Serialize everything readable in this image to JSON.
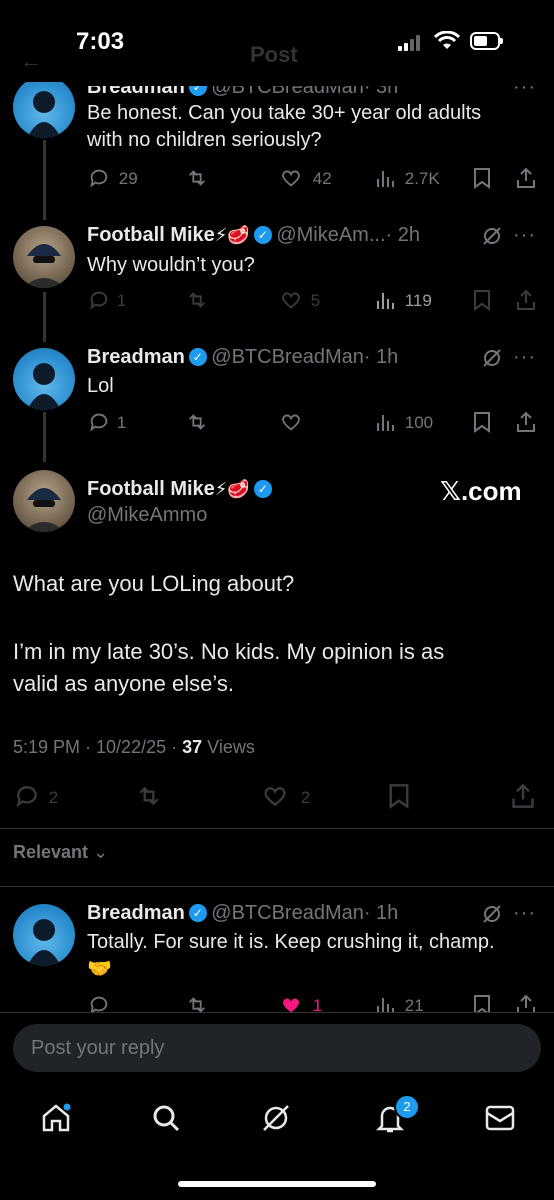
{
  "status": {
    "time": "7:03"
  },
  "header": {
    "back": "←",
    "title": "Post"
  },
  "thread": [
    {
      "author": "Breadman",
      "handle": "@BTCBreadMan",
      "age": "· 3h",
      "text_lines": [
        "Be honest. Can you take 30+ year old adults",
        "with no children seriously?"
      ],
      "replies": "29",
      "reposts": "",
      "likes": "42",
      "views": "2.7K"
    },
    {
      "author": "Football Mike",
      "emoji": "⚡🥩",
      "handle": "@MikeAm...",
      "age": "· 2h",
      "text_lines": [
        "Why wouldn’t you?"
      ],
      "replies": "1",
      "reposts": "",
      "likes": "5",
      "views": "119"
    },
    {
      "author": "Breadman",
      "handle": "@BTCBreadMan",
      "age": "· 1h",
      "text_lines": [
        "Lol"
      ],
      "replies": "1",
      "reposts": "",
      "likes": "",
      "views": "100"
    }
  ],
  "main_post": {
    "author": "Football Mike",
    "emoji": "⚡🥩",
    "handle": "@MikeAmmo",
    "watermark": "𝕏.com",
    "text_line1": "What are you LOLing about?",
    "text_line2": "I’m in my late 30’s. No kids. My opinion is as",
    "text_line3": "valid as anyone else’s.",
    "timestamp": "5:19 PM · 10/22/25 · ",
    "views_count": "37",
    "views_label": "Views",
    "replies": "2",
    "likes": "2"
  },
  "sort": {
    "label": "Relevant"
  },
  "reply": {
    "author": "Breadman",
    "handle": "@BTCBreadMan",
    "age": "· 1h",
    "text": "Totally. For sure it is. Keep crushing it, champ.",
    "emoji": "🤝",
    "replies": "",
    "likes": "1",
    "views": "21"
  },
  "composer": {
    "placeholder": "Post your reply"
  },
  "tabbar": {
    "notification_count": "2"
  },
  "colors": {
    "accent": "#1d9bf0",
    "like": "#f91880",
    "muted": "#71767b",
    "background": "#000000"
  }
}
